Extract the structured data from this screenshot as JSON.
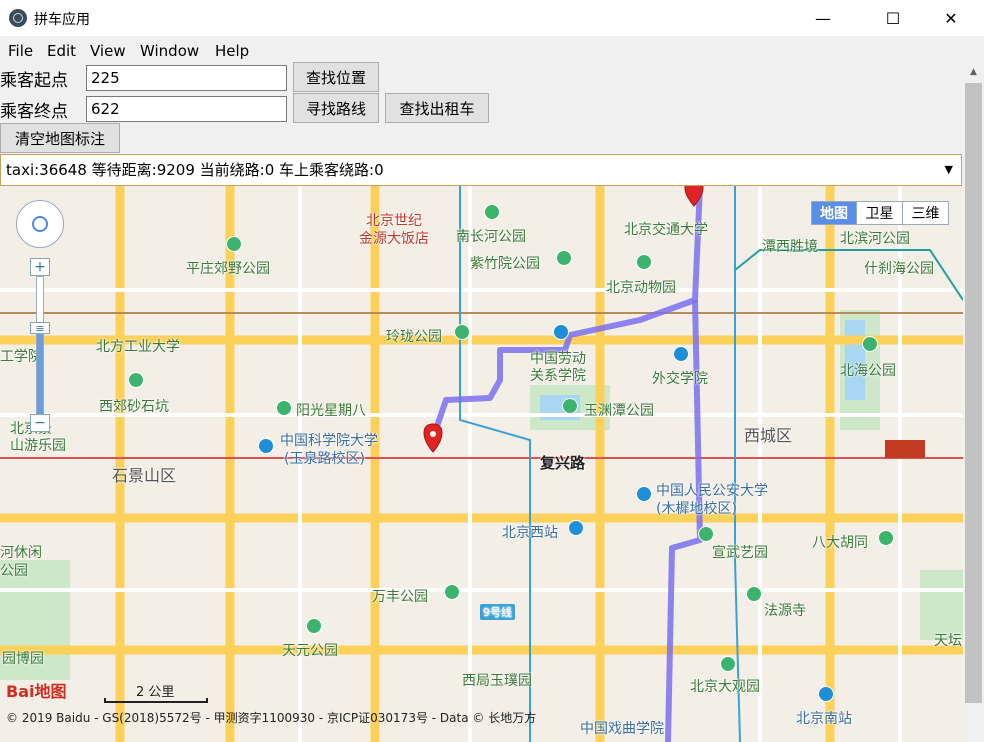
{
  "window": {
    "title": "拼车应用",
    "minimize": "—",
    "maximize": "☐",
    "close": "✕"
  },
  "menu": [
    "File",
    "Edit",
    "View",
    "Window",
    "Help"
  ],
  "form": {
    "start_label": "乘客起点",
    "start_value": "225",
    "end_label": "乘客终点",
    "end_value": "622",
    "find_location": "查找位置",
    "find_route": "寻找路线",
    "find_taxi": "查找出租车",
    "clear_markers": "清空地图标注"
  },
  "taxi_select": {
    "selected": "taxi:36648 等待距离:9209 当前绕路:0 车上乘客绕路:0",
    "arrow": "▼"
  },
  "map": {
    "map_types": [
      "地图",
      "卫星",
      "三维"
    ],
    "active_type": "地图",
    "zoom_in": "+",
    "zoom_out": "−",
    "scale_label": "2 公里",
    "logo": "Bai地图",
    "copyright": "© 2019 Baidu - GS(2018)5572号 - 甲测资字1100930 - 京ICP证030173号 - Data © 长地万方",
    "labels": {
      "l01": "北京世纪",
      "l02": "金源大饭店",
      "l03": "南长河公园",
      "l04": "北京交通大学",
      "l05": "潭西胜境",
      "l06": "北滨河公园",
      "l07": "平庄郊野公园",
      "l08": "紫竹院公园",
      "l09": "北京动物园",
      "l10": "什刹海公园",
      "l11": "玲珑公园",
      "l12": "北方工业大学",
      "l13": "中国劳动",
      "l14": "关系学院",
      "l15": "外交学院",
      "l16": "北海公园",
      "l17": "工学院",
      "l18": "西郊砂石坑",
      "l19": "阳光星期八",
      "l20": "玉渊潭公园",
      "l21": "北京景",
      "l22": "山游乐园",
      "l23": "中国科学院大学",
      "l24": "(玉泉路校区)",
      "l25": "复兴路",
      "l26": "西城区",
      "l27": "石景山区",
      "l28": "中国人民公安大学",
      "l29": "(木樨地校区)",
      "l30": "北京西站",
      "l31": "宣武艺园",
      "l32": "八大胡同",
      "l33": "河休闲",
      "l34": "公园",
      "l35": "万丰公园",
      "l36": "9号线",
      "l37": "法源寺",
      "l38": "天元公园",
      "l39": "园博园",
      "l40": "北京大观园",
      "l41": "天坛",
      "l42": "西局玉璞园",
      "l43": "北京南站",
      "l44": "中国戏曲学院"
    }
  },
  "colors": {
    "route": "#7b6ff0",
    "pin": "#e02424",
    "accent": "#5b8ee6"
  }
}
